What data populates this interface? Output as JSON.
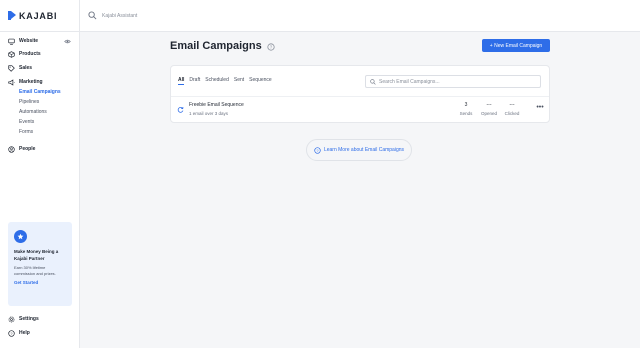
{
  "app": {
    "brand": "KAJABI",
    "assistant_placeholder": "Kajabi Assistant"
  },
  "sidebar": {
    "items": [
      {
        "label": "Website",
        "icon": "monitor-icon"
      },
      {
        "label": "Products",
        "icon": "box-icon"
      },
      {
        "label": "Sales",
        "icon": "tag-icon"
      },
      {
        "label": "Marketing",
        "icon": "megaphone-icon"
      },
      {
        "label": "People",
        "icon": "people-icon"
      }
    ],
    "marketing_sub": [
      {
        "label": "Email Campaigns",
        "active": true
      },
      {
        "label": "Pipelines"
      },
      {
        "label": "Automations"
      },
      {
        "label": "Events"
      },
      {
        "label": "Forms"
      }
    ],
    "promo": {
      "title": "Make Money Being a Kajabi Partner",
      "body": "Earn 30% lifetime commission and prizes.",
      "link": "Get Started"
    },
    "bottom": [
      {
        "label": "Settings",
        "icon": "gear-icon"
      },
      {
        "label": "Help",
        "icon": "help-icon"
      }
    ]
  },
  "main": {
    "title": "Email Campaigns",
    "new_button": "+ New Email Campaign",
    "tabs": [
      "All",
      "Draft",
      "Scheduled",
      "Sent",
      "Sequence"
    ],
    "search_placeholder": "Search Email Campaigns...",
    "campaigns": [
      {
        "name": "Freebie Email Sequence",
        "meta": "1 email over 3 days",
        "sends": "3",
        "opened": "---",
        "clicked": "---"
      }
    ],
    "stat_labels": {
      "sends": "Sends",
      "opened": "Opened",
      "clicked": "Clicked"
    },
    "more": "•••",
    "learn_more": "Learn More about Email Campaigns"
  },
  "colors": {
    "accent": "#2e6de8",
    "background": "#f5f6f8"
  }
}
